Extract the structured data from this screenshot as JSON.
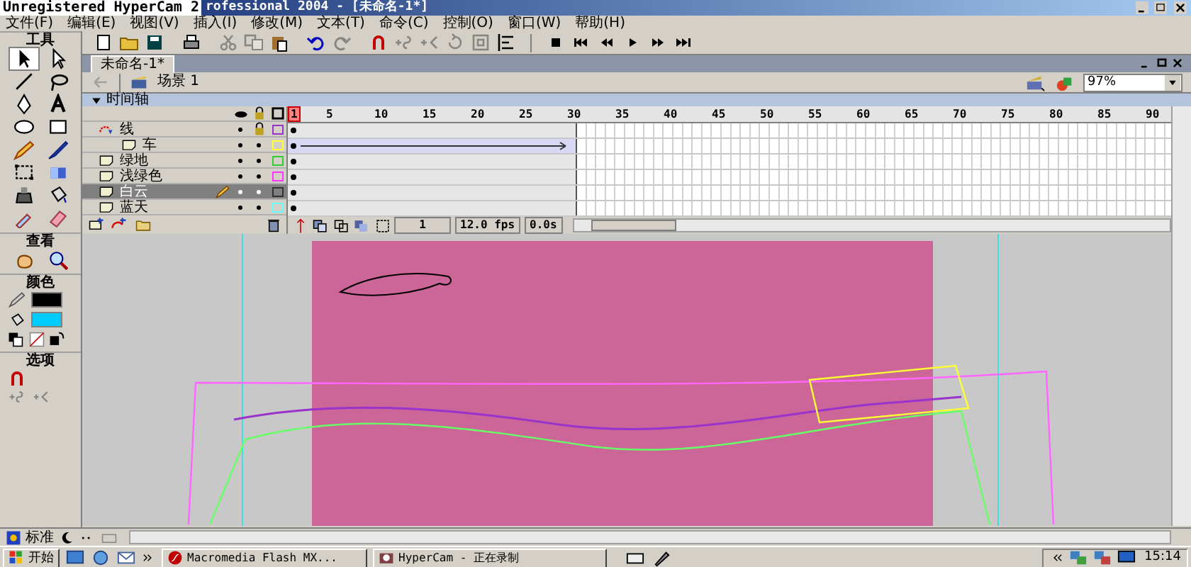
{
  "title_bar": {
    "watermark": "Unregistered HyperCam 2",
    "title": "rofessional 2004 - [未命名-1*]"
  },
  "menu": [
    "文件(F)",
    "编辑(E)",
    "视图(V)",
    "插入(I)",
    "修改(M)",
    "文本(T)",
    "命令(C)",
    "控制(O)",
    "窗口(W)",
    "帮助(H)"
  ],
  "toolbar": [
    {
      "disabled": false
    },
    {
      "disabled": false
    },
    {
      "disabled": false
    },
    {
      "disabled": false
    },
    {
      "disabled": true
    },
    {
      "disabled": true
    },
    {
      "disabled": false
    },
    {
      "disabled": false
    },
    {
      "disabled": true
    },
    {
      "disabled": false
    },
    {
      "disabled": true
    },
    {
      "disabled": true
    },
    {
      "disabled": true
    },
    {
      "disabled": true
    },
    {
      "disabled": false
    },
    {
      "disabled": false
    },
    {
      "disabled": false
    },
    {
      "disabled": false
    },
    {
      "disabled": false
    },
    {
      "disabled": false
    },
    {
      "disabled": false
    }
  ],
  "tools_panel": {
    "title": "工具",
    "tools": [
      {
        "selected": true
      },
      {
        "selected": false
      },
      {
        "selected": false
      },
      {
        "selected": false
      },
      {
        "selected": false
      },
      {
        "selected": false
      },
      {
        "selected": false
      },
      {
        "selected": false
      },
      {
        "selected": false
      },
      {
        "selected": false
      },
      {
        "selected": false
      },
      {
        "selected": false
      },
      {
        "selected": false
      },
      {
        "selected": false
      },
      {
        "selected": false
      },
      {
        "selected": false
      }
    ],
    "view_title": "查看",
    "colors_title": "颜色",
    "stroke": {
      "color": "#000000"
    },
    "fill": {
      "color": "#00ccff"
    },
    "options_title": "选项"
  },
  "document": {
    "tab": "未命名-1*",
    "scene": "场景 1",
    "zoom": "97%"
  },
  "timeline": {
    "title": "时间轴",
    "layers": [
      {
        "name": "线",
        "kind": "guide",
        "selected": false,
        "locked": true,
        "color": "#9933cc",
        "tween": false,
        "children": [
          {
            "name": "车",
            "kind": "normal",
            "selected": false,
            "locked": false,
            "color": "#ffff33",
            "tween": true
          }
        ]
      },
      {
        "name": "绿地",
        "kind": "normal",
        "selected": false,
        "locked": false,
        "color": "#33cc33",
        "tween": false
      },
      {
        "name": "浅绿色",
        "kind": "normal",
        "selected": false,
        "locked": false,
        "color": "#ff33ff",
        "tween": false
      },
      {
        "name": "白云",
        "kind": "normal",
        "selected": true,
        "locked": false,
        "color": "#333333",
        "tween": false
      },
      {
        "name": "蓝天",
        "kind": "normal",
        "selected": false,
        "locked": false,
        "color": "#66ffff",
        "tween": false
      }
    ],
    "frame_ticks": [
      "1",
      "5",
      "10",
      "15",
      "20",
      "25",
      "30",
      "35",
      "40",
      "45",
      "50",
      "55",
      "60",
      "65",
      "70",
      "75",
      "80",
      "85",
      "90"
    ],
    "current_frame": "1",
    "frame_rate": "12.0 fps",
    "elapsed": "0.0s"
  },
  "status": {
    "mode": "标准"
  },
  "taskbar": {
    "start": "开始",
    "tasks": [
      {
        "label": "Macromedia Flash MX...",
        "selected": false
      },
      {
        "label": "HyperCam - 正在录制",
        "selected": false
      }
    ],
    "clock": "15:14"
  }
}
